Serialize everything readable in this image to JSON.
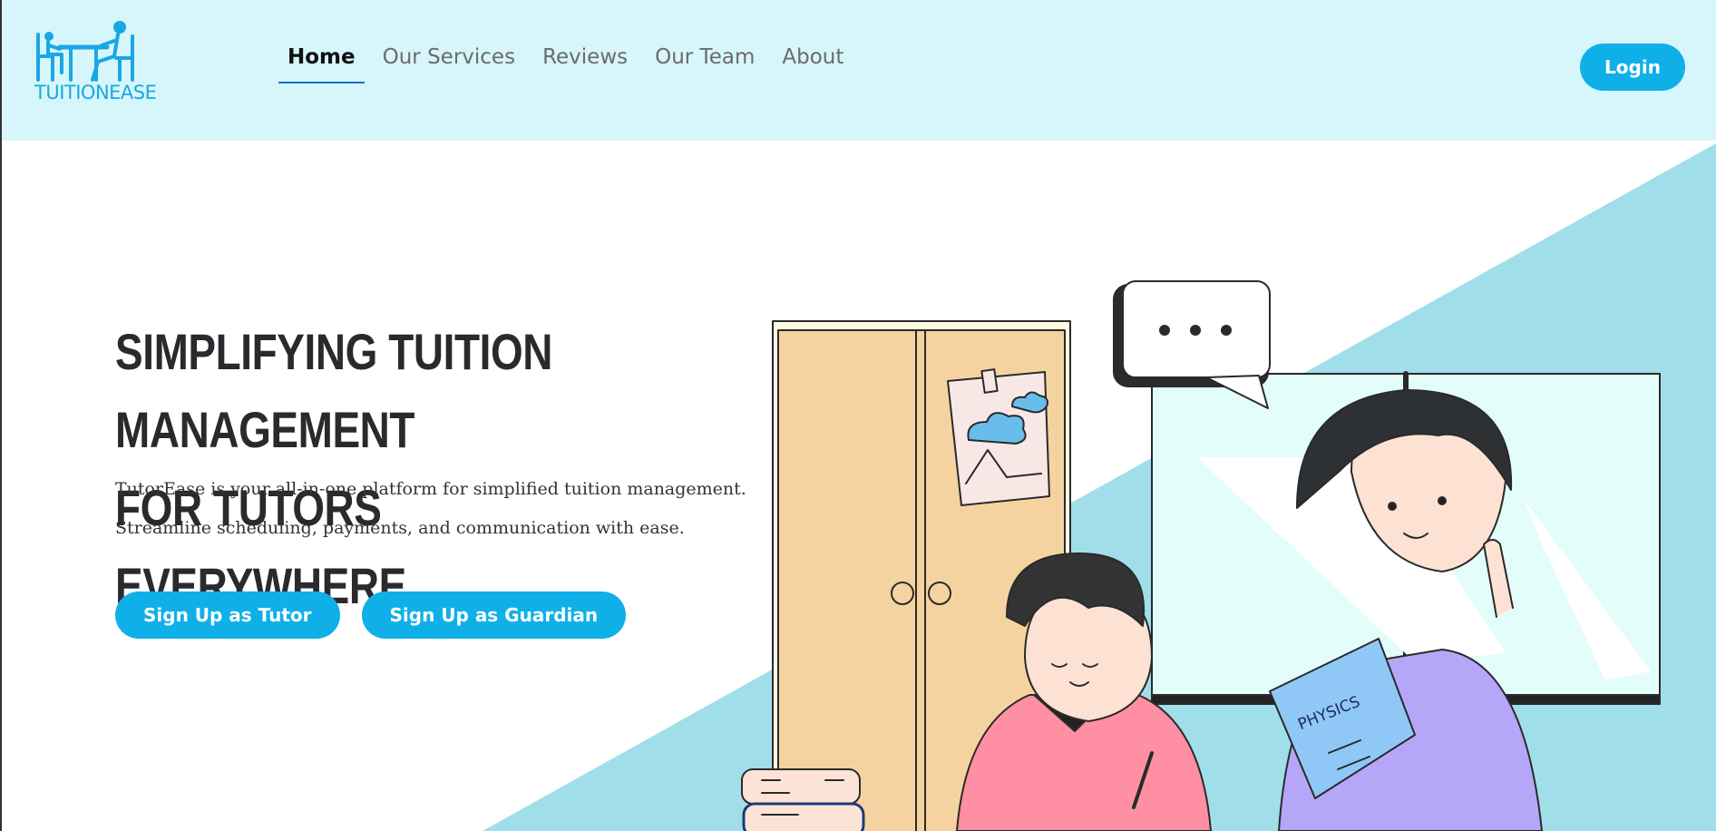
{
  "brand": {
    "logo_text": "TUITIONEASE"
  },
  "nav": {
    "items": [
      {
        "label": "Home",
        "active": true
      },
      {
        "label": "Our Services",
        "active": false
      },
      {
        "label": "Reviews",
        "active": false
      },
      {
        "label": "Our Team",
        "active": false
      },
      {
        "label": "About",
        "active": false
      }
    ]
  },
  "header": {
    "login_label": "Login"
  },
  "hero": {
    "title_line1": "Simplifying Tuition Management",
    "title_line2": "for Tutors Everywhere",
    "desc_line1": "TutorEase is your all-in-one platform for simplified tuition management.",
    "desc_line2": "Streamline scheduling, payments, and communication with ease.",
    "cta_tutor": "Sign Up as Tutor",
    "cta_guardian": "Sign Up as Guardian"
  },
  "illustration": {
    "book_label": "PHYSICS"
  },
  "colors": {
    "header_bg": "#d6f6fb",
    "accent": "#0fb0e8",
    "hero_diagonal": "#a0dfea"
  }
}
